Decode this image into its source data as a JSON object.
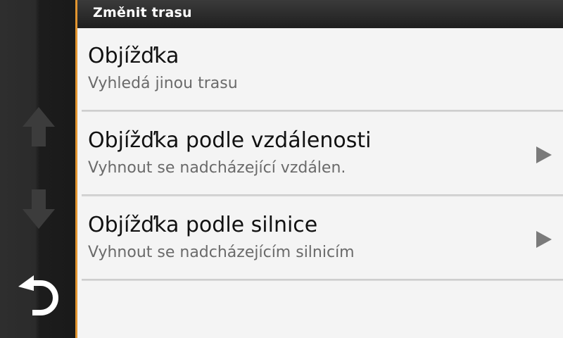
{
  "header": {
    "title": "Změnit trasu"
  },
  "sidebar": {
    "up_icon": "arrow-up-icon",
    "down_icon": "arrow-down-icon",
    "back_icon": "back-icon"
  },
  "colors": {
    "accent": "#e3952f",
    "background": "#f4f4f4",
    "sidebar": "#1c1c1c"
  },
  "items": [
    {
      "title": "Objížďka",
      "subtitle": "Vyhledá jinou trasu",
      "has_arrow": false
    },
    {
      "title": "Objížďka podle vzdálenosti",
      "subtitle": "Vyhnout se nadcházející vzdálen.",
      "has_arrow": true
    },
    {
      "title": "Objížďka podle silnice",
      "subtitle": "Vyhnout se nadcházejícím silnicím",
      "has_arrow": true
    }
  ]
}
